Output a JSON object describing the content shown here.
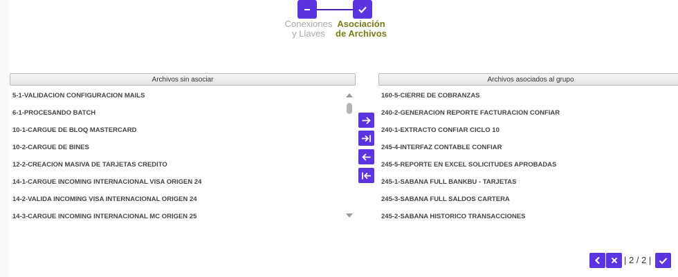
{
  "stepper": {
    "steps": [
      {
        "line1": "Conexiones",
        "line2": "y Llaves",
        "icon": "minus-icon"
      },
      {
        "line1": "Asociación",
        "line2": "de Archivos",
        "icon": "check-icon"
      }
    ]
  },
  "left_panel": {
    "title": "Archivos sin asociar",
    "items": [
      "5-1-VALIDACION CONFIGURACION MAILS",
      "6-1-PROCESANDO BATCH",
      "10-1-CARGUE DE BLOQ MASTERCARD",
      "10-2-CARGUE DE BINES",
      "12-2-CREACION MASIVA DE TARJETAS CREDITO",
      "14-1-CARGUE INCOMING INTERNACIONAL VISA ORIGEN 24",
      "14-2-VALIDA INCOMING VISA INTERNACIONAL ORIGEN 24",
      "14-3-CARGUE INCOMING INTERNACIONAL MC ORIGEN 25"
    ]
  },
  "right_panel": {
    "title": "Archivos asociados al grupo",
    "items": [
      "160-5-CIERRE DE COBRANZAS",
      "240-2-GENERACION REPORTE FACTURACION CONFIAR",
      "240-1-EXTRACTO CONFIAR CICLO 10",
      "245-4-INTERFAZ CONTABLE CONFIAR",
      "245-5-REPORTE EN EXCEL SOLICITUDES APROBADAS",
      "245-1-SABANA FULL BANKBU - TARJETAS",
      "245-3-SABANA FULL SALDOS CARTERA",
      "245-2-SABANA HISTORICO TRANSACCIONES"
    ]
  },
  "transfer_buttons": [
    "arrow-right-icon",
    "arrow-right-all-icon",
    "arrow-left-icon",
    "arrow-left-all-icon"
  ],
  "pager": {
    "text": "| 2 / 2 |"
  },
  "colors": {
    "accent": "#5b34e0",
    "active_step_label": "#7a7a18",
    "inactive_step_label": "#a8a8a8"
  }
}
